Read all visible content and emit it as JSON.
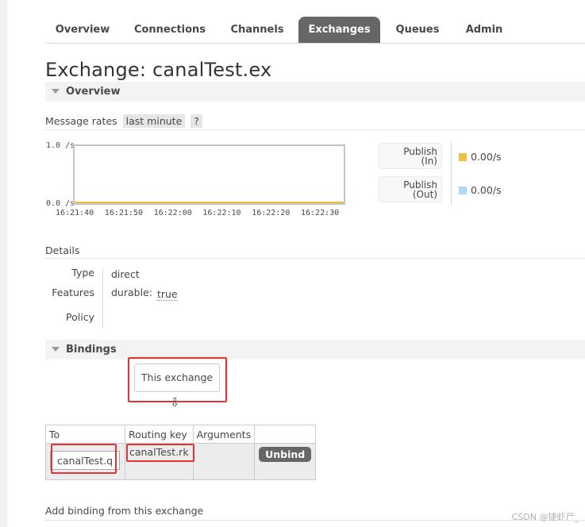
{
  "nav": {
    "tabs": [
      {
        "label": "Overview",
        "active": false
      },
      {
        "label": "Connections",
        "active": false
      },
      {
        "label": "Channels",
        "active": false
      },
      {
        "label": "Exchanges",
        "active": true
      },
      {
        "label": "Queues",
        "active": false
      },
      {
        "label": "Admin",
        "active": false
      }
    ]
  },
  "page": {
    "title": "Exchange: canalTest.ex"
  },
  "overview": {
    "heading": "Overview",
    "message_rates_label": "Message rates",
    "period": "last minute",
    "help": "?"
  },
  "chart_data": {
    "type": "line",
    "x": [
      "16:21:40",
      "16:21:50",
      "16:22:00",
      "16:22:10",
      "16:22:20",
      "16:22:30"
    ],
    "ylim": [
      0.0,
      1.0
    ],
    "y_tick_labels": [
      "1.0 /s",
      "0.0 /s"
    ],
    "series": [
      {
        "name": "Publish (In)",
        "values": [
          0,
          0,
          0,
          0,
          0,
          0
        ],
        "color": "#edc240"
      },
      {
        "name": "Publish (Out)",
        "values": [
          0,
          0,
          0,
          0,
          0,
          0
        ],
        "color": "#afd8f8"
      }
    ]
  },
  "legend": [
    {
      "line1": "Publish",
      "line2": "(In)",
      "value": "0.00/s",
      "color": "#edc240"
    },
    {
      "line1": "Publish",
      "line2": "(Out)",
      "value": "0.00/s",
      "color": "#afd8f8"
    }
  ],
  "details": {
    "heading": "Details",
    "type_label": "Type",
    "type_value": "direct",
    "features_label": "Features",
    "features_key": "durable:",
    "features_value": "true",
    "policy_label": "Policy"
  },
  "bindings": {
    "heading": "Bindings",
    "this_exchange": "This exchange",
    "arrow": "⇩",
    "columns": [
      "To",
      "Routing key",
      "Arguments"
    ],
    "rows": [
      {
        "to": "canalTest.q",
        "routing_key": "canalTest.rk",
        "arguments": "",
        "action": "Unbind"
      }
    ],
    "add_binding": "Add binding from this exchange"
  },
  "watermark": "CSDN @捷虾尸_"
}
